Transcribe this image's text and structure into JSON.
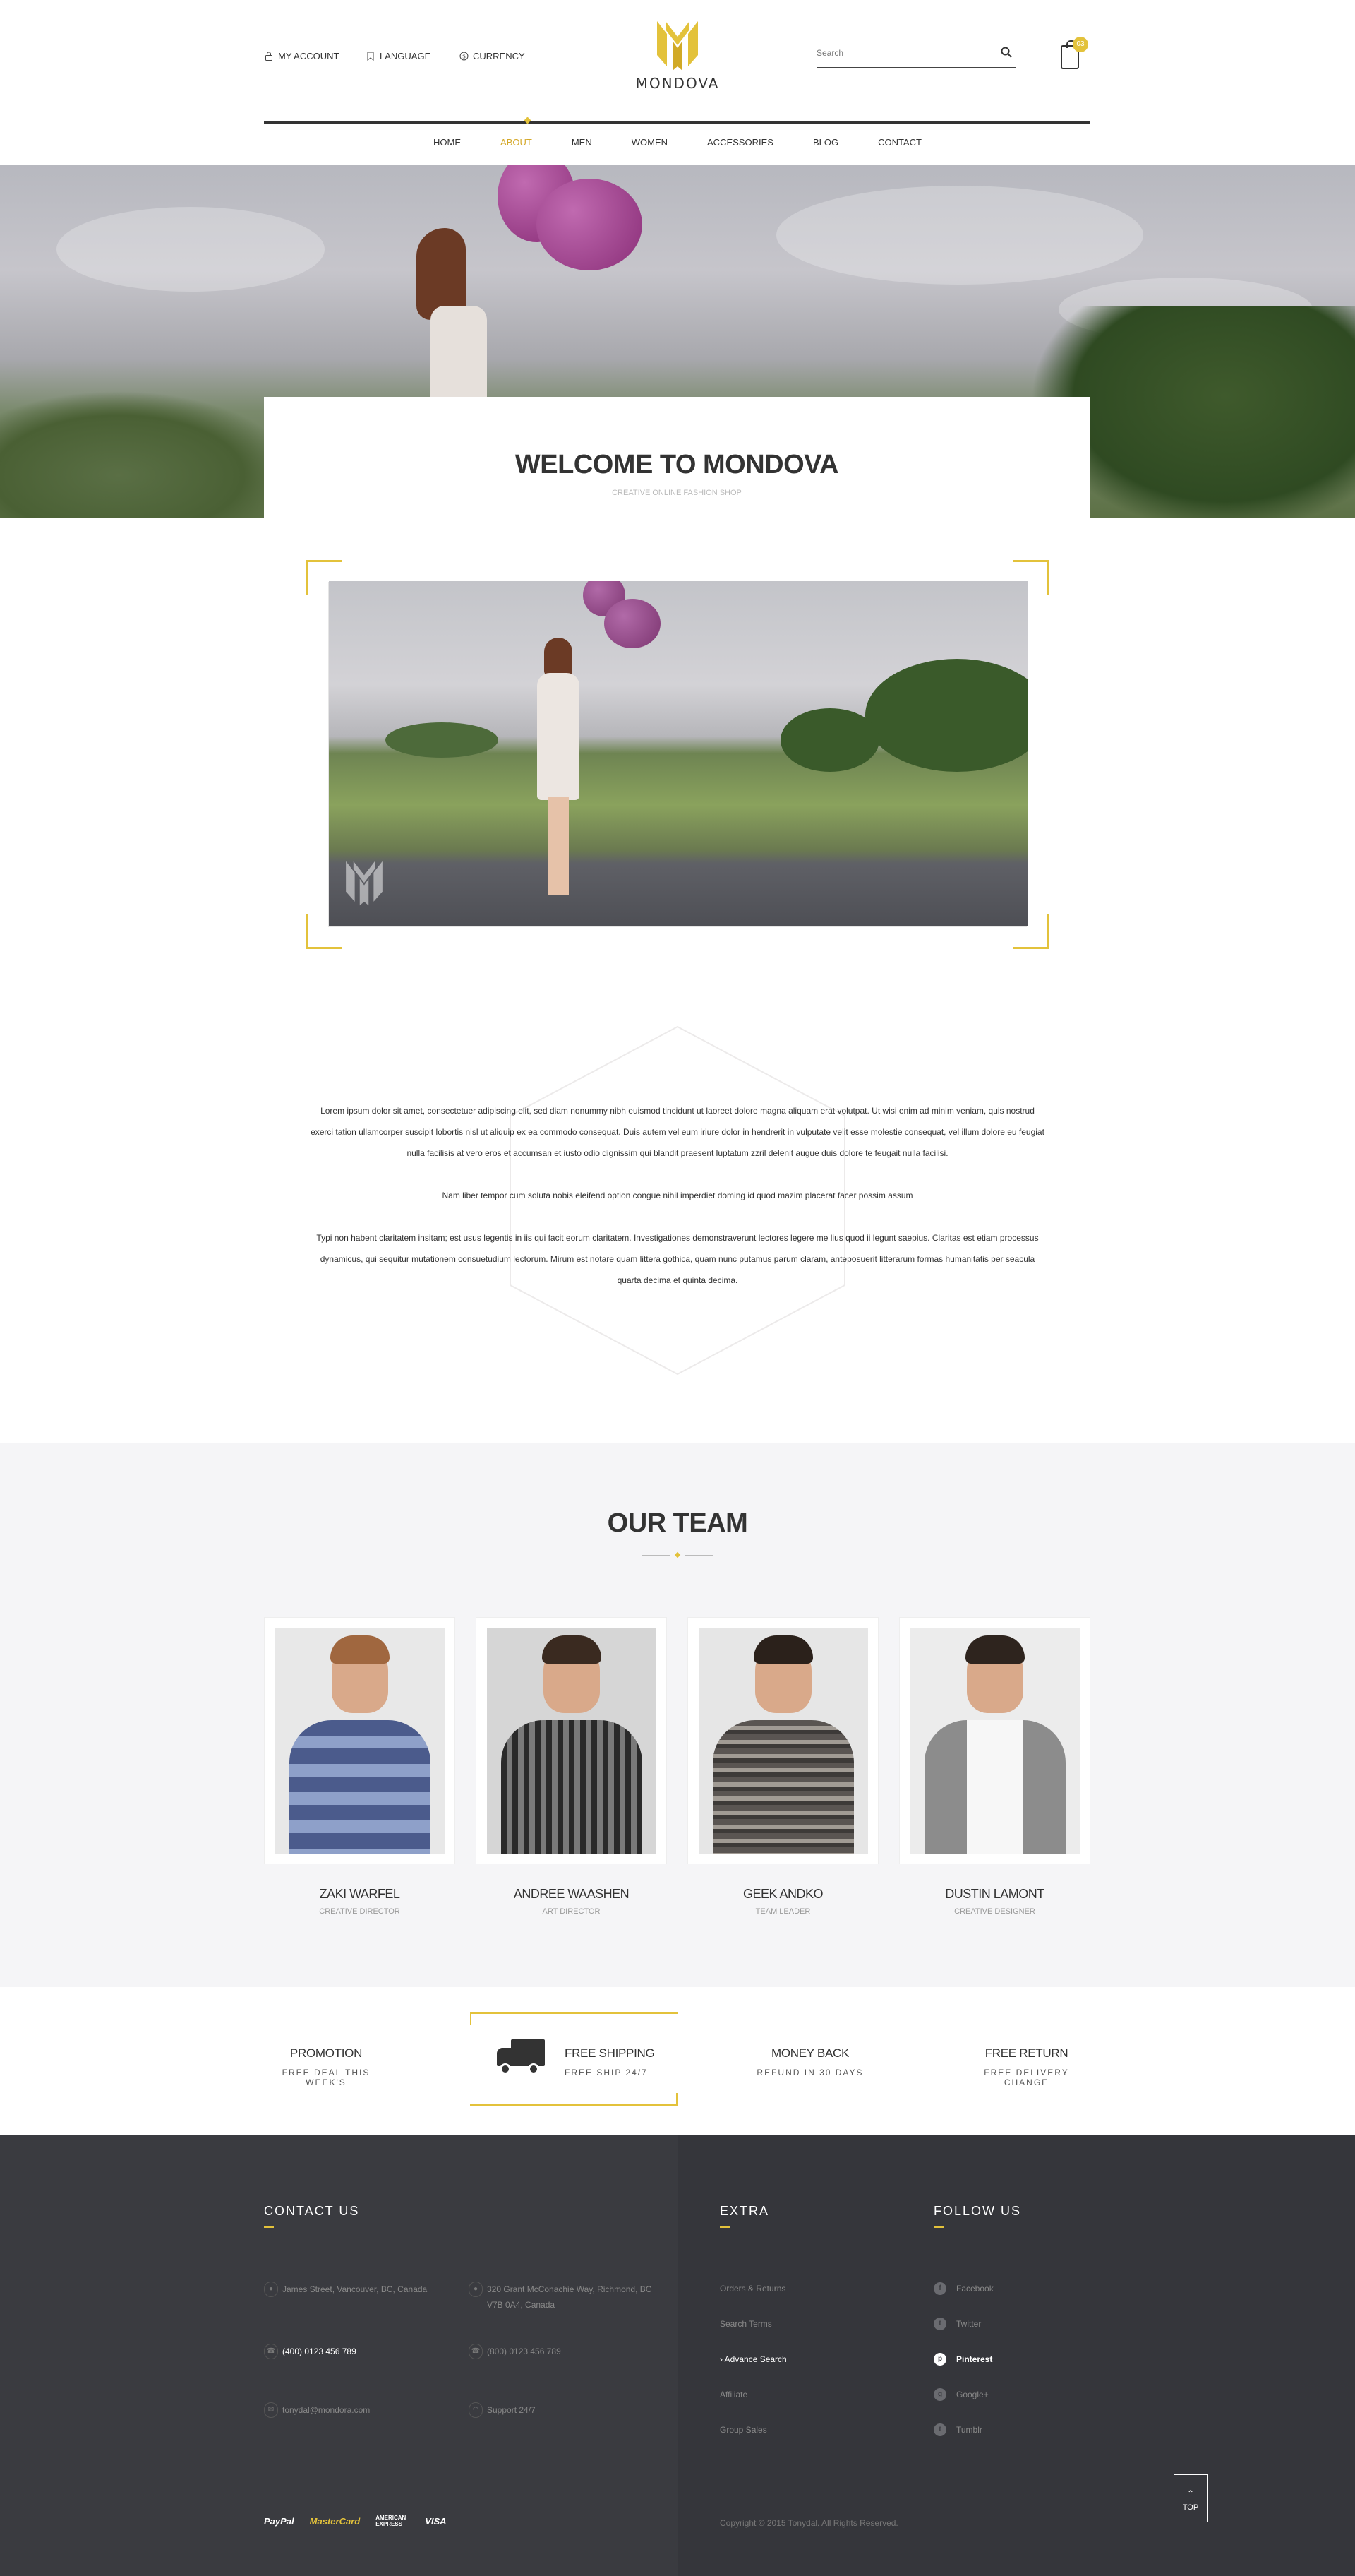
{
  "header": {
    "top_links": [
      {
        "icon": "lock-icon",
        "label": "MY ACCOUNT"
      },
      {
        "icon": "bookmark-icon",
        "label": "LANGUAGE"
      },
      {
        "icon": "currency-icon",
        "label": "CURRENCY"
      }
    ],
    "logo_text": "MONDOVA",
    "search": {
      "placeholder": "Search",
      "value": "Search"
    },
    "cart_count": "03",
    "nav": [
      {
        "label": "HOME",
        "active": false
      },
      {
        "label": "ABOUT",
        "active": true
      },
      {
        "label": "MEN",
        "active": false
      },
      {
        "label": "WOMEN",
        "active": false
      },
      {
        "label": "ACCESSORIES",
        "active": false
      },
      {
        "label": "BLOG",
        "active": false
      },
      {
        "label": "CONTACT",
        "active": false
      }
    ]
  },
  "welcome": {
    "title": "WELCOME TO MONDOVA",
    "subtitle": "CREATIVE ONLINE FASHION SHOP"
  },
  "about": {
    "paragraphs": [
      "Lorem ipsum dolor sit amet, consectetuer adipiscing elit, sed diam nonummy nibh euismod tincidunt ut laoreet dolore magna aliquam erat volutpat. Ut wisi enim ad minim veniam, quis nostrud exerci tation ullamcorper suscipit lobortis nisl ut aliquip ex ea commodo consequat. Duis autem vel eum iriure dolor in hendrerit in vulputate velit esse molestie consequat, vel illum dolore eu feugiat nulla facilisis at vero eros et accumsan et iusto odio dignissim qui blandit praesent luptatum zzril delenit augue duis dolore te feugait nulla facilisi.",
      "Nam liber tempor cum soluta nobis eleifend option congue nihil imperdiet doming id quod mazim placerat facer possim assum",
      "Typi non habent claritatem insitam; est usus legentis in iis qui facit eorum claritatem. Investigationes demonstraverunt lectores legere me lius quod ii legunt saepius. Claritas est etiam processus dynamicus, qui sequitur mutationem consuetudium lectorum. Mirum est notare quam littera gothica, quam nunc putamus parum claram, anteposuerit litterarum formas humanitatis per seacula quarta decima et quinta decima."
    ]
  },
  "team": {
    "title": "OUR TEAM",
    "members": [
      {
        "name": "ZAKI WARFEL",
        "role": "CREATIVE DIRECTOR"
      },
      {
        "name": "ANDREE WAASHEN",
        "role": "ART DIRECTOR"
      },
      {
        "name": "GEEK ANDKO",
        "role": "TEAM LEADER"
      },
      {
        "name": "DUSTIN LAMONT",
        "role": "CREATIVE DESIGNER"
      }
    ]
  },
  "features": [
    {
      "title": "PROMOTION",
      "sub": "FREE DEAL THIS WEEK'S"
    },
    {
      "title": "FREE SHIPPING",
      "sub": "FREE SHIP 24/7"
    },
    {
      "title": "MONEY BACK",
      "sub": "REFUND IN 30 DAYS"
    },
    {
      "title": "FREE RETURN",
      "sub": "FREE DELIVERY CHANGE"
    }
  ],
  "footer": {
    "contact_title": "CONTACT US",
    "contacts": [
      {
        "icon": "map-pin-icon",
        "text": "James Street, Vancouver, BC, Canada"
      },
      {
        "icon": "map-pin-icon",
        "text": "320 Grant McConachie Way, Richmond, BC V7B 0A4, Canada"
      },
      {
        "icon": "phone-icon",
        "text": "(400) 0123 456 789"
      },
      {
        "icon": "phone-icon",
        "text": "(800) 0123 456 789"
      },
      {
        "icon": "mail-icon",
        "text": "tonydal@mondora.com"
      },
      {
        "icon": "headset-icon",
        "text": "Support 24/7"
      }
    ],
    "extra_title": "EXTRA",
    "extra_links": [
      {
        "label": "Orders & Returns",
        "active": false
      },
      {
        "label": "Search Terms",
        "active": false
      },
      {
        "label": "Advance Search",
        "active": true
      },
      {
        "label": "Affiliate",
        "active": false
      },
      {
        "label": "Group Sales",
        "active": false
      }
    ],
    "follow_title": "FOLLOW US",
    "follow_links": [
      {
        "icon": "facebook-icon",
        "glyph": "f",
        "label": "Facebook",
        "active": false
      },
      {
        "icon": "twitter-icon",
        "glyph": "t",
        "label": "Twitter",
        "active": false
      },
      {
        "icon": "pinterest-icon",
        "glyph": "p",
        "label": "Pinterest",
        "active": true
      },
      {
        "icon": "google-plus-icon",
        "glyph": "g",
        "label": "Google+",
        "active": false
      },
      {
        "icon": "tumblr-icon",
        "glyph": "t",
        "label": "Tumblr",
        "active": false
      }
    ],
    "payments": [
      "PayPal",
      "MasterCard",
      "AMERICAN EXPRESS",
      "VISA"
    ],
    "copyright": "Copyright © 2015 Tonydal. All Rights Reserved.",
    "top_label": "TOP"
  },
  "colors": {
    "accent": "#e3c23b",
    "footer_bg": "#3a3b40",
    "team_bg": "#f5f5f7"
  }
}
